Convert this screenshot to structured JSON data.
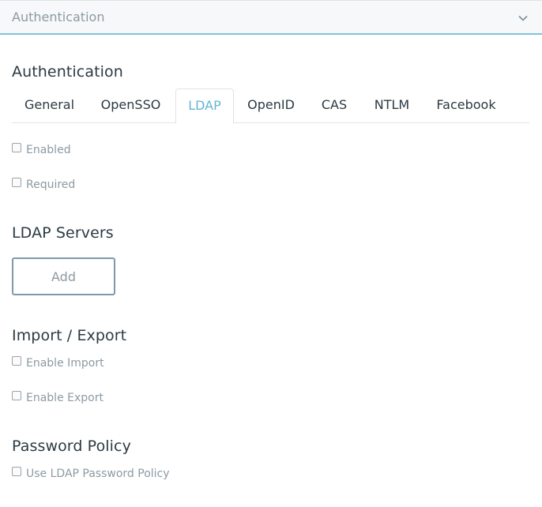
{
  "panel": {
    "title": "Authentication",
    "toggle_icon": "chevron-down-icon"
  },
  "main": {
    "title": "Authentication",
    "tabs": [
      {
        "label": "General",
        "active": false
      },
      {
        "label": "OpenSSO",
        "active": false
      },
      {
        "label": "LDAP",
        "active": true
      },
      {
        "label": "OpenID",
        "active": false
      },
      {
        "label": "CAS",
        "active": false
      },
      {
        "label": "NTLM",
        "active": false
      },
      {
        "label": "Facebook",
        "active": false
      }
    ]
  },
  "ldap": {
    "enabled_label": "Enabled",
    "required_label": "Required",
    "servers": {
      "title": "LDAP Servers",
      "add_label": "Add"
    },
    "import_export": {
      "title": "Import / Export",
      "enable_import_label": "Enable Import",
      "enable_export_label": "Enable Export"
    },
    "password_policy": {
      "title": "Password Policy",
      "use_policy_label": "Use LDAP Password Policy"
    }
  },
  "colors": {
    "accent": "#65b6d4",
    "muted_text": "#8c9aa3",
    "heading_text": "#2b3a42"
  }
}
